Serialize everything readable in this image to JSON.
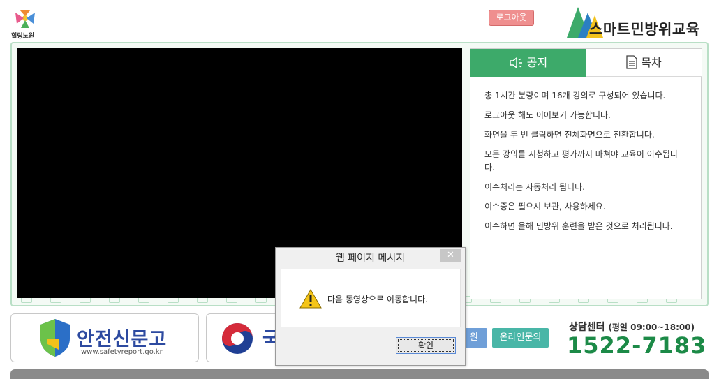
{
  "header": {
    "logo_text": "힐링노원",
    "logout_label": "로그아웃",
    "brand_title": "스마트민방위교육"
  },
  "tabs": {
    "notice_label": "공지",
    "toc_label": "목차"
  },
  "notices": [
    "총 1시간 분량이며 16개 강의로 구성되어 있습니다.",
    "로그아웃 해도 이어보기 가능합니다.",
    "화면을 두 번 클릭하면 전체화면으로 전환합니다.",
    "모든 강의를 시청하고 평가까지 마쳐야 교육이 이수됩니다.",
    "이수처리는 자동처리 됩니다.",
    "이수증은 필요시 보관, 사용하세요.",
    "이수하면 올해 민방위 훈련을 받은 것으로 처리됩니다."
  ],
  "banners": {
    "safety_title": "안전신문고",
    "safety_url": "www.safetyreport.go.kr",
    "gov_title": "국",
    "rec_label": "원",
    "online_label": "온라인문의"
  },
  "consult": {
    "label": "상담센터",
    "hours": "(평일 09:00~18:00)",
    "phone": "1522-7183"
  },
  "dialog": {
    "title": "웹 페이지 메시지",
    "close": "✕",
    "message": "다음 동영상으로 이동합니다.",
    "ok_label": "확인"
  },
  "colors": {
    "accent_green": "#3daa6a",
    "phone_green": "#1c8a47",
    "logout_pink": "#ef8f8f",
    "banner_blue": "#2d4aa0"
  }
}
